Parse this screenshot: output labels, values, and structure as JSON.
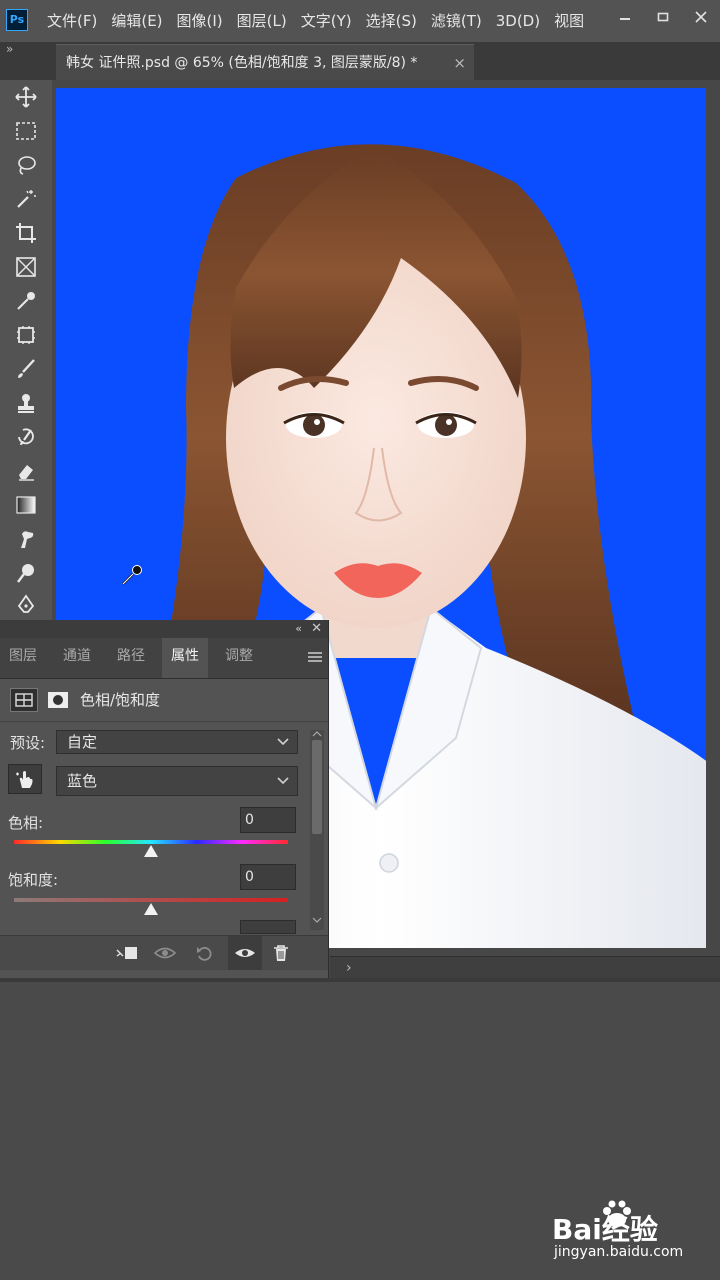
{
  "app": {
    "logo_text": "Ps"
  },
  "menu": {
    "items": [
      "文件(F)",
      "编辑(E)",
      "图像(I)",
      "图层(L)",
      "文字(Y)",
      "选择(S)",
      "滤镜(T)",
      "3D(D)",
      "视图"
    ]
  },
  "document_tab": {
    "title": "韩女 证件照.psd @ 65% (色相/饱和度 3, 图层蒙版/8) *",
    "close_glyph": "×"
  },
  "tools": [
    "move-icon",
    "marquee-icon",
    "lasso-icon",
    "magic-wand-icon",
    "crop-icon",
    "frame-icon",
    "eyedropper-icon",
    "patch-icon",
    "brush-icon",
    "stamp-icon",
    "history-brush-icon",
    "eraser-icon",
    "gradient-icon",
    "smudge-icon",
    "dodge-icon",
    "pen-icon"
  ],
  "panel": {
    "tabs": [
      "图层",
      "通道",
      "路径",
      "属性",
      "调整"
    ],
    "active_tab": "属性",
    "adjustment_title": "色相/饱和度",
    "preset_label": "预设:",
    "preset_value": "自定",
    "channel_value": "蓝色",
    "hue_label": "色相:",
    "hue_value": "0",
    "saturation_label": "饱和度:",
    "saturation_value": "0",
    "hue_slider_fraction": 0.5,
    "saturation_slider_fraction": 0.5
  },
  "colors": {
    "background_blue": "#0a4eff",
    "ui_dark": "#535353",
    "panel_bg": "#535353"
  },
  "watermark": {
    "brand": "Bai经验",
    "url": "jingyan.baidu.com"
  }
}
